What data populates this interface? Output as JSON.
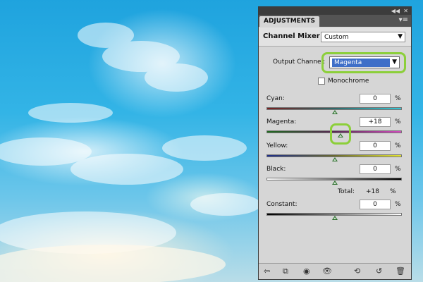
{
  "panel": {
    "tab": "ADJUSTMENTS",
    "menu_icon": "panel-menu-icon",
    "collapse_icon": "collapse-icon",
    "close_icon": "close-icon",
    "title": "Channel Mixer",
    "preset": "Custom",
    "output_channel_label": "Output Channel:",
    "output_channel_value": "Magenta",
    "monochrome_label": "Monochrome",
    "monochrome_checked": false,
    "sliders": [
      {
        "label": "Cyan:",
        "value": "0",
        "unit": "%",
        "level": 0
      },
      {
        "label": "Magenta:",
        "value": "+18",
        "unit": "%",
        "level": 18
      },
      {
        "label": "Yellow:",
        "value": "0",
        "unit": "%",
        "level": 0
      },
      {
        "label": "Black:",
        "value": "0",
        "unit": "%",
        "level": 0
      }
    ],
    "total_label": "Total:",
    "total_value": "+18",
    "total_unit": "%",
    "constant": {
      "label": "Constant:",
      "value": "0",
      "unit": "%",
      "level": 0
    },
    "footer_icons": [
      "back-arrow-icon",
      "expand-view-icon",
      "clip-layer-icon",
      "visibility-eye-icon",
      "view-previous-icon",
      "reset-icon",
      "trash-icon"
    ],
    "highlight_color": "#8ccf3a"
  }
}
